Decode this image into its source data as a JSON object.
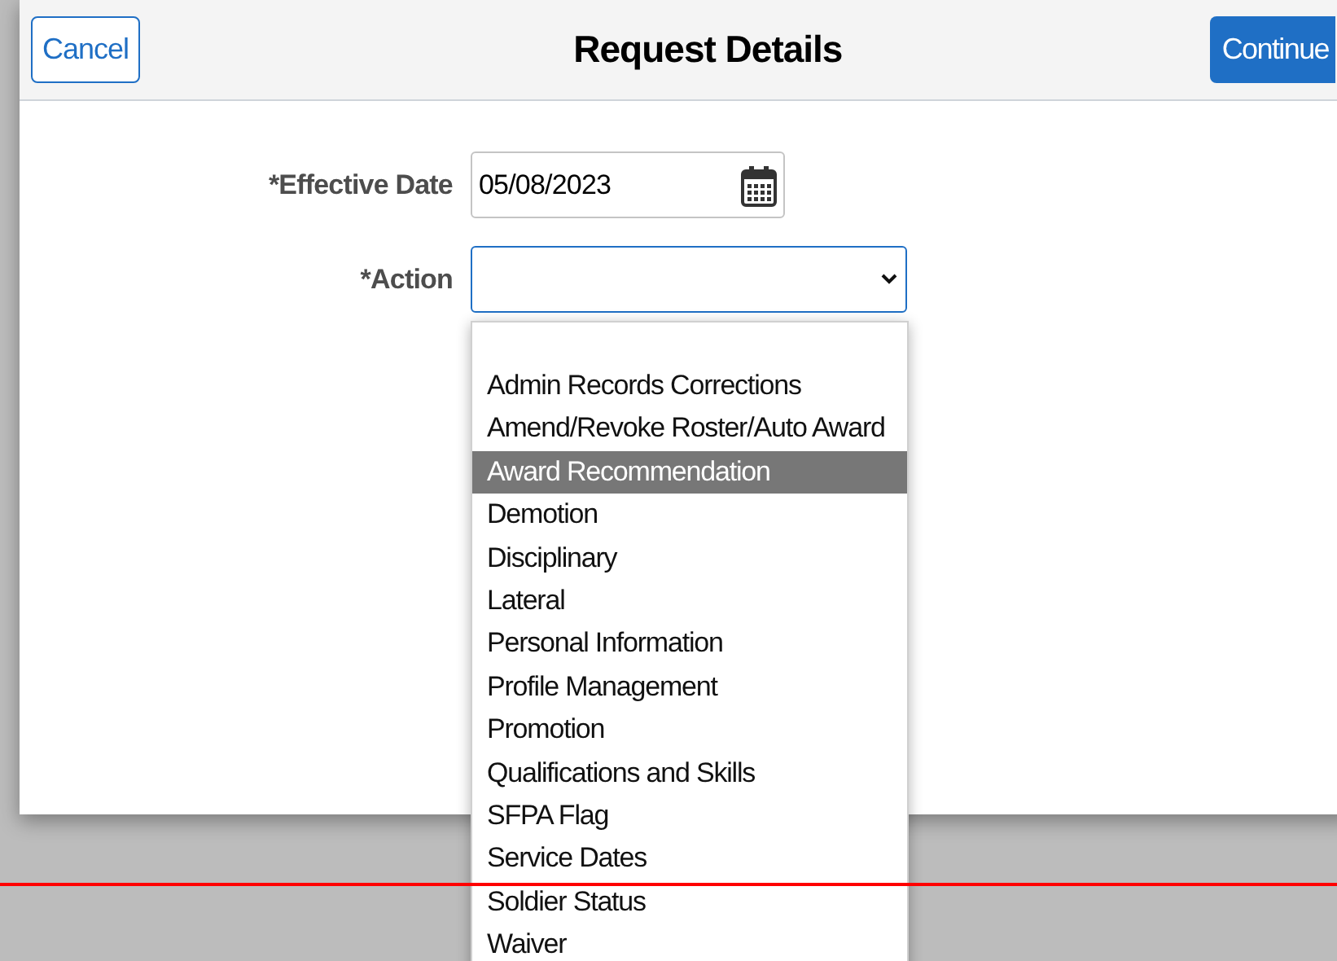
{
  "header": {
    "cancel": "Cancel",
    "title": "Request Details",
    "continue": "Continue"
  },
  "form": {
    "effective_date": {
      "label": "*Effective Date",
      "value": "05/08/2023"
    },
    "action": {
      "label": "*Action"
    }
  },
  "dropdown": {
    "options": [
      {
        "label": "Admin Records Corrections",
        "selected": false
      },
      {
        "label": "Amend/Revoke Roster/Auto Award",
        "selected": false
      },
      {
        "label": "Award Recommendation",
        "selected": true
      },
      {
        "label": "Demotion",
        "selected": false
      },
      {
        "label": "Disciplinary",
        "selected": false
      },
      {
        "label": "Lateral",
        "selected": false
      },
      {
        "label": "Personal Information",
        "selected": false
      },
      {
        "label": "Profile Management",
        "selected": false
      },
      {
        "label": "Promotion",
        "selected": false
      },
      {
        "label": "Qualifications and Skills",
        "selected": false
      },
      {
        "label": "SFPA Flag",
        "selected": false
      },
      {
        "label": "Service Dates",
        "selected": false
      },
      {
        "label": "Soldier Status",
        "selected": false
      },
      {
        "label": "Waiver",
        "selected": false
      }
    ]
  }
}
